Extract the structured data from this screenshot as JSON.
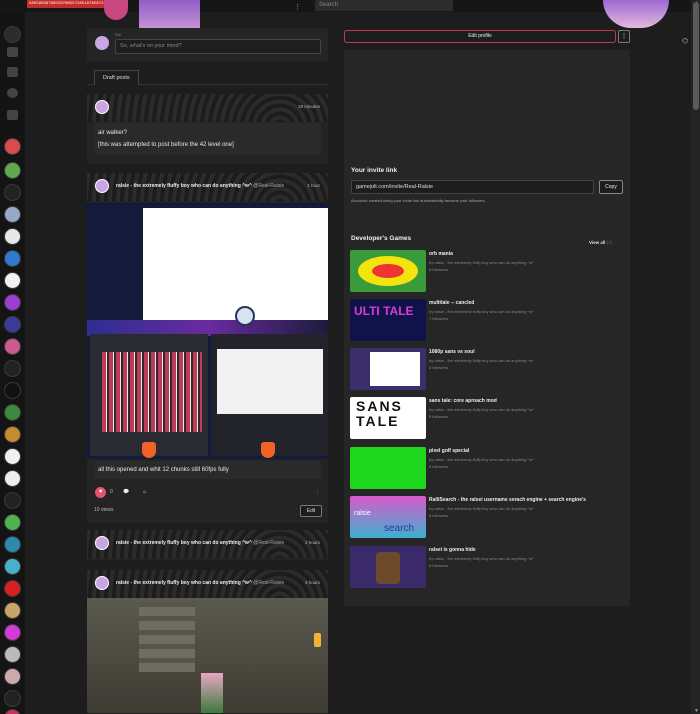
{
  "top": {
    "debug_text": "585585887985207085572851878587217679506",
    "search_placeholder": "Search"
  },
  "composer": {
    "name_label": "Rai",
    "placeholder": "So, what's on your mind?"
  },
  "tabs": [
    {
      "label": "Draft posts"
    }
  ],
  "posts": [
    {
      "time": "19 minutes",
      "text_lines": [
        "air walker?",
        "[this was attempted to post before the 42 level one]"
      ]
    },
    {
      "author": "ralsie - the extremely fluffy boy who can do anything ^w^",
      "handle": "@Real-Ralsie",
      "time": "1 hour",
      "text": "all this opened and whit 12 chunks still 60fps fully",
      "like_count": "0",
      "views": "10 views",
      "edit_label": "Edit"
    },
    {
      "author": "ralsie - the extremely fluffy boy who can do anything ^w^",
      "handle": "@Real-Ralsie",
      "time": "2 hours"
    },
    {
      "author": "ralsie - the extremely fluffy boy who can do anything ^w^",
      "handle": "@Real-Ralsie",
      "time": "3 hours"
    }
  ],
  "profile": {
    "edit_label": "Edit profile",
    "menu_label": "⋮"
  },
  "invite": {
    "title": "Your invite link",
    "link": "gamejolt.com/invite/Real-Ralsie",
    "copy_label": "Copy",
    "note": "Accounts created using your invite link automatically become your followers."
  },
  "games": {
    "title": "Developer's Games",
    "view_all": "View all",
    "view_all_count": "(7)",
    "items": [
      {
        "title": "orb mania",
        "by": "by ralsie - the extremely fluffy boy who can do anything ^w^",
        "followers": "8 followers"
      },
      {
        "title": "multitale -- cancled",
        "by": "by ralsie - the extremely fluffy boy who can do anything ^w^",
        "followers": "7 followers"
      },
      {
        "title": "1080p sans vs soul",
        "by": "by ralsie - the extremely fluffy boy who can do anything ^w^",
        "followers": "8 followers"
      },
      {
        "title": "sans tale: core aproach mod",
        "by": "by ralsie - the extremely fluffy boy who can do anything ^w^",
        "followers": "8 followers"
      },
      {
        "title": "pixel golf special",
        "by": "by ralsie - the extremely fluffy boy who can do anything ^w^",
        "followers": "8 followers"
      },
      {
        "title": "RalliSearch - the ralsei username serach engine + search engine's",
        "by": "by ralsie - the extremely fluffy boy who can do anything ^w^",
        "followers": "8 followers",
        "thumb_text": [
          "ralsie",
          "search"
        ]
      },
      {
        "title": "ralsei is gonna hide",
        "by": "by ralsie - the extremely fluffy boy who can do anything ^w^",
        "followers": "8 followers"
      }
    ]
  },
  "thumb_texts": {
    "multitale": "ULTI TALE",
    "sans": "SANS TALE"
  },
  "colors": {
    "accent": "#c23b4c",
    "like": "#e0556b"
  }
}
